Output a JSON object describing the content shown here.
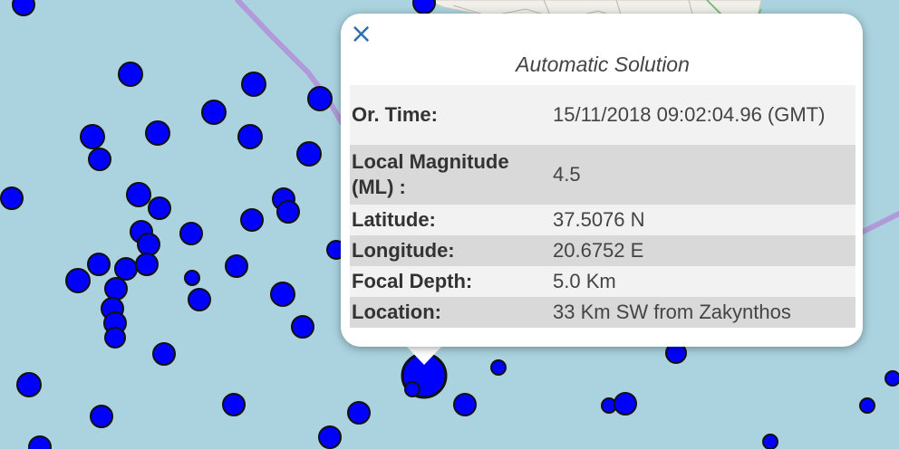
{
  "map": {
    "sea_color": "#aad3df",
    "land_color": "#f0efe9",
    "border_color": "#b19ad9",
    "marker_color": "#0000ff",
    "marker_stroke": "#111111"
  },
  "popup": {
    "close_label": "×",
    "title": "Automatic Solution",
    "rows": [
      {
        "label": "Or. Time:",
        "value": "15/11/2018 09:02:04.96 (GMT)"
      },
      {
        "label": "Local Magnitude (ML) :",
        "value": "4.5"
      },
      {
        "label": "Latitude:",
        "value": "37.5076 N"
      },
      {
        "label": "Longitude:",
        "value": "20.6752 E"
      },
      {
        "label": "Focal Depth:",
        "value": "5.0 Km"
      },
      {
        "label": "Location:",
        "value": "33 Km SW from Zakynthos"
      }
    ]
  }
}
